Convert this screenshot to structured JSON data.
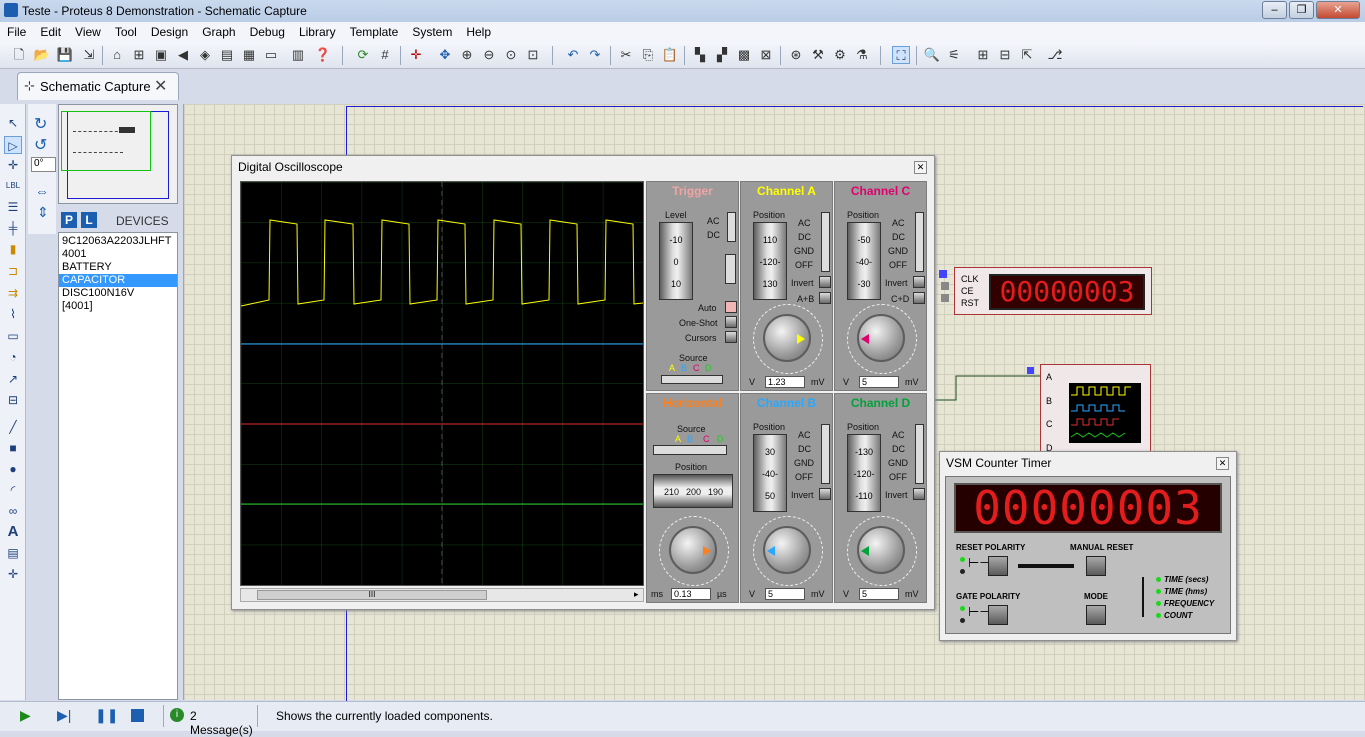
{
  "window": {
    "title": "Teste - Proteus 8 Demonstration - Schematic Capture"
  },
  "menu": [
    "File",
    "Edit",
    "View",
    "Tool",
    "Design",
    "Graph",
    "Debug",
    "Library",
    "Template",
    "System",
    "Help"
  ],
  "tab": {
    "label": "Schematic Capture"
  },
  "rotation": {
    "value": "0°"
  },
  "devices": {
    "header": "DEVICES",
    "p_label": "P",
    "l_label": "L",
    "items": [
      "9C12063A2203JLHFT",
      "4001",
      "BATTERY",
      "CAPACITOR",
      "DISC100N16V",
      "[4001]"
    ],
    "selected_index": 3
  },
  "oscilloscope": {
    "title": "Digital Oscilloscope",
    "trigger": {
      "title": "Trigger",
      "level_label": "Level",
      "ac": "AC",
      "dc": "DC",
      "auto": "Auto",
      "one_shot": "One-Shot",
      "cursors": "Cursors",
      "source_label": "Source",
      "sources": [
        "A",
        "B",
        "C",
        "D"
      ],
      "drum": [
        "-10",
        "0",
        "10"
      ]
    },
    "channel_a": {
      "title": "Channel A",
      "position_label": "Position",
      "modes": [
        "AC",
        "DC",
        "GND",
        "OFF"
      ],
      "invert": "Invert",
      "extra": "A+B",
      "drum": [
        "110",
        "-120-",
        "130"
      ],
      "unit_left": "V",
      "value": "1.23",
      "unit_right": "mV",
      "color": "#ffff00"
    },
    "channel_b": {
      "title": "Channel B",
      "position_label": "Position",
      "modes": [
        "AC",
        "DC",
        "GND",
        "OFF"
      ],
      "invert": "Invert",
      "drum": [
        "30",
        "-40-",
        "50"
      ],
      "unit_left": "V",
      "value": "5",
      "unit_right": "mV",
      "color": "#2aa7ff"
    },
    "channel_c": {
      "title": "Channel C",
      "position_label": "Position",
      "modes": [
        "AC",
        "DC",
        "GND",
        "OFF"
      ],
      "invert": "Invert",
      "extra": "C+D",
      "drum": [
        "-50",
        "-40-",
        "-30"
      ],
      "unit_left": "V",
      "value": "5",
      "unit_right": "mV",
      "color": "#e0006e"
    },
    "channel_d": {
      "title": "Channel D",
      "position_label": "Position",
      "modes": [
        "AC",
        "DC",
        "GND",
        "OFF"
      ],
      "invert": "Invert",
      "drum": [
        "-130",
        "-120-",
        "-110"
      ],
      "unit_left": "V",
      "value": "5",
      "unit_right": "mV",
      "color": "#009933"
    },
    "horizontal": {
      "title": "Horizontal",
      "source_label": "Source",
      "sources": [
        "A",
        "B",
        "C",
        "D"
      ],
      "position_label": "Position",
      "drum": [
        "210",
        "200",
        "190"
      ],
      "unit_left": "ms",
      "value": "0.13",
      "unit_right": "µs"
    },
    "scroll_mark": "III"
  },
  "counter_component": {
    "pins": [
      "CLK",
      "CE",
      "RST"
    ],
    "display": "00000003"
  },
  "scope_component": {
    "pins": [
      "A",
      "B",
      "C",
      "D"
    ]
  },
  "vsm": {
    "title": "VSM Counter Timer",
    "display": "00000003",
    "reset_polarity": "RESET POLARITY",
    "manual_reset": "MANUAL RESET",
    "gate_polarity": "GATE POLARITY",
    "mode": "MODE",
    "modes": [
      "TIME (secs)",
      "TIME (hms)",
      "FREQUENCY",
      "COUNT"
    ]
  },
  "status": {
    "messages": "2 Message(s)",
    "text": "Shows the currently loaded components."
  }
}
